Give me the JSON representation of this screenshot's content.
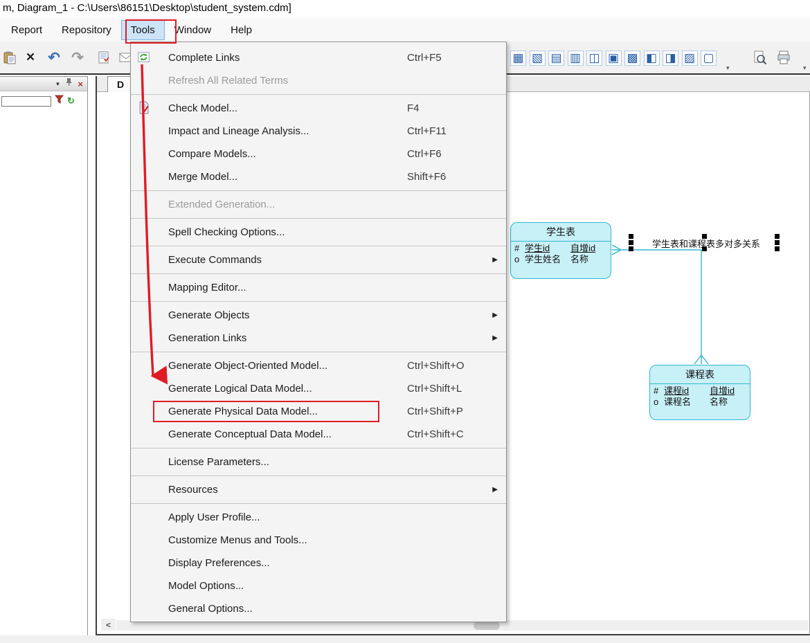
{
  "window_title": "m, Diagram_1 - C:\\Users\\86151\\Desktop\\student_system.cdm]",
  "menu_bar": {
    "items": [
      {
        "label": "Report"
      },
      {
        "label": "Repository"
      },
      {
        "label": "Tools",
        "active": true
      },
      {
        "label": "Window"
      },
      {
        "label": "Help"
      }
    ]
  },
  "toolbar": {
    "delete_glyph": "×",
    "undo_glyph": "↶",
    "redo_glyph": "↷",
    "overflow_chevron": "▾",
    "right_icons": [
      {
        "name": "diagram-tool-icon-1",
        "glyph": "▦"
      },
      {
        "name": "diagram-tool-icon-2",
        "glyph": "▧"
      },
      {
        "name": "diagram-tool-icon-3",
        "glyph": "▤"
      },
      {
        "name": "diagram-tool-icon-4",
        "glyph": "▥"
      },
      {
        "name": "diagram-tool-icon-5",
        "glyph": "◫"
      },
      {
        "name": "diagram-tool-icon-6",
        "glyph": "▣"
      },
      {
        "name": "diagram-tool-icon-7",
        "glyph": "▩"
      },
      {
        "name": "diagram-tool-icon-8",
        "glyph": "◧"
      },
      {
        "name": "diagram-tool-icon-9",
        "glyph": "◨"
      },
      {
        "name": "diagram-tool-icon-10",
        "glyph": "▨"
      },
      {
        "name": "diagram-tool-icon-11",
        "glyph": "▢"
      }
    ]
  },
  "left_panel": {
    "search_value": ""
  },
  "tab": {
    "label": "D"
  },
  "tools_menu": {
    "submenu_glyph": "▶",
    "items": [
      {
        "label": "Complete Links",
        "shortcut": "Ctrl+F5",
        "icon": "complete-links-icon"
      },
      {
        "label": "Refresh All Related Terms",
        "disabled": true
      },
      {
        "sep": true
      },
      {
        "label": "Check Model...",
        "shortcut": "F4",
        "icon": "check-model-icon"
      },
      {
        "label": "Impact and Lineage Analysis...",
        "shortcut": "Ctrl+F11"
      },
      {
        "label": "Compare Models...",
        "shortcut": "Ctrl+F6"
      },
      {
        "label": "Merge Model...",
        "shortcut": "Shift+F6"
      },
      {
        "sep": true
      },
      {
        "label": "Extended Generation...",
        "disabled": true
      },
      {
        "sep": true
      },
      {
        "label": "Spell Checking Options..."
      },
      {
        "sep": true
      },
      {
        "label": "Execute Commands",
        "submenu": true
      },
      {
        "sep": true
      },
      {
        "label": "Mapping Editor..."
      },
      {
        "sep": true
      },
      {
        "label": "Generate Objects",
        "submenu": true
      },
      {
        "label": "Generation Links",
        "submenu": true
      },
      {
        "sep": true
      },
      {
        "label": "Generate Object-Oriented Model...",
        "shortcut": "Ctrl+Shift+O"
      },
      {
        "label": "Generate Logical Data Model...",
        "shortcut": "Ctrl+Shift+L"
      },
      {
        "label": "Generate Physical Data Model...",
        "shortcut": "Ctrl+Shift+P",
        "highlighted": true
      },
      {
        "label": "Generate Conceptual Data Model...",
        "shortcut": "Ctrl+Shift+C"
      },
      {
        "sep": true
      },
      {
        "label": "License Parameters..."
      },
      {
        "sep": true
      },
      {
        "label": "Resources",
        "submenu": true
      },
      {
        "sep": true
      },
      {
        "label": "Apply User Profile..."
      },
      {
        "label": "Customize Menus and Tools..."
      },
      {
        "label": "Display Preferences..."
      },
      {
        "label": "Model Options..."
      },
      {
        "label": "General Options..."
      }
    ]
  },
  "diagram": {
    "entities": [
      {
        "title": "学生表",
        "rows": [
          {
            "marker": "#",
            "name": "学生id",
            "code": "自增id",
            "identifier": true
          },
          {
            "marker": "o",
            "name": "学生姓名",
            "code": "名称",
            "identifier": false
          }
        ]
      },
      {
        "title": "课程表",
        "rows": [
          {
            "marker": "#",
            "name": "课程id",
            "code": "自增id",
            "identifier": true
          },
          {
            "marker": "o",
            "name": "课程名",
            "code": "名称",
            "identifier": false
          }
        ]
      }
    ],
    "relationship_label": "学生表和课程表多对多关系"
  },
  "scroll": {
    "left_arrow": "<"
  },
  "colors": {
    "annotation_red": "#e01b24",
    "entity_fill": "#c8f0f7",
    "entity_border": "#2fb7cf",
    "accent_blue": "#2a5fa5"
  }
}
